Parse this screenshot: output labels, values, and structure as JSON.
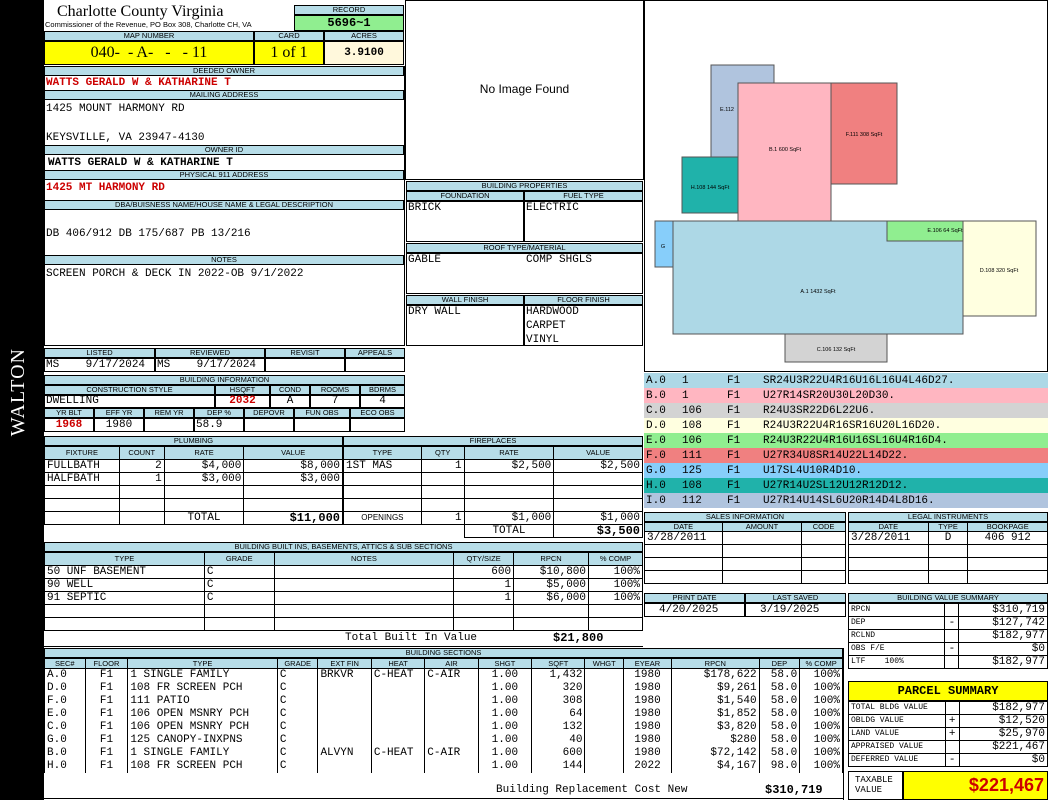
{
  "sidebar_text": "WALTON",
  "header": {
    "county": "Charlotte County Virginia",
    "commissioner": "Commissioner of the Revenue, PO Box 308, Charlotte CH, VA",
    "record_label": "RECORD",
    "record": "5696~1",
    "map_label": "MAP NUMBER",
    "map": "040-  - A-   -   - 11",
    "card_label": "CARD",
    "card": "1 of 1",
    "acres_label": "ACRES",
    "acres": "3.9100"
  },
  "owner": {
    "deeded_label": "DEEDED OWNER",
    "deeded": "WATTS GERALD W & KATHARINE T",
    "mailing_label": "MAILING ADDRESS",
    "mail1": "1425 MOUNT HARMONY RD",
    "mail2": "KEYSVILLE, VA 23947-4130",
    "owner_id_label": "OWNER ID",
    "owner_id": "WATTS GERALD W & KATHARINE T",
    "phys_label": "PHYSICAL 911 ADDRESS",
    "phys": "1425 MT HARMONY RD",
    "dba_label": "DBA/BUISNESS NAME/HOUSE NAME & LEGAL DESCRIPTION",
    "dba": "DB 406/912 DB 175/687 PB 13/216",
    "notes_label": "NOTES",
    "notes": "SCREEN PORCH & DECK IN 2022-OB 9/1/2022"
  },
  "image_text": "No Image Found",
  "listed": {
    "listed_label": "LISTED",
    "listed": "MS    9/17/2024",
    "reviewed_label": "REVIEWED",
    "reviewed": "MS    9/17/2024",
    "revisit_label": "REVISIT",
    "appeals_label": "APPEALS"
  },
  "building_info": {
    "label": "BUILDING INFORMATION",
    "cs_label": "CONSTRUCTION STYLE",
    "cs": "DWELLING",
    "hsqft_label": "HSQFT",
    "hsqft": "2032",
    "cond_label": "COND",
    "cond": "A",
    "rooms_label": "ROOMS",
    "rooms": "7",
    "bdrms_label": "BDRMS",
    "bdrms": "4",
    "yrblt_label": "YR BLT",
    "yrblt": "1968",
    "effyr_label": "EFF YR",
    "effyr": "1980",
    "remyr_label": "REM YR",
    "dep_label": "DEP %",
    "dep": "58.9",
    "depovr_label": "DEPOVR",
    "funobs_label": "FUN OBS",
    "ecoobs_label": "ECO OBS"
  },
  "bprops": {
    "label": "BUILDING PROPERTIES",
    "foundation_label": "FOUNDATION",
    "foundation": "BRICK",
    "fuel_label": "FUEL TYPE",
    "fuel": "ELECTRIC",
    "roof_label": "ROOF TYPE/MATERIAL",
    "roof1": "GABLE",
    "roof2": "COMP SHGLS",
    "wall_label": "WALL FINISH",
    "wall": "DRY WALL",
    "floor_label": "FLOOR FINISH",
    "floors": [
      "HARDWOOD",
      "CARPET",
      "VINYL"
    ]
  },
  "plumbing": {
    "label": "PLUMBING",
    "headers": [
      "FIXTURE",
      "COUNT",
      "RATE",
      "VALUE"
    ],
    "rows": [
      [
        "FULLBATH",
        "2",
        "$4,000",
        "$8,000"
      ],
      [
        "HALFBATH",
        "1",
        "$3,000",
        "$3,000"
      ]
    ],
    "total_label": "TOTAL",
    "total": "$11,000"
  },
  "fireplaces": {
    "label": "FIREPLACES",
    "headers": [
      "TYPE",
      "QTY",
      "RATE",
      "VALUE"
    ],
    "rows": [
      [
        "1ST MAS",
        "1",
        "$2,500",
        "$2,500"
      ]
    ],
    "openings_label": "OPENINGS",
    "openings": [
      "1",
      "$1,000",
      "$1,000"
    ],
    "total_label": "TOTAL",
    "total": "$3,500"
  },
  "builtins": {
    "label": "BUILDING BUILT INS, BASEMENTS, ATTICS & SUB SECTIONS",
    "headers": [
      "TYPE",
      "GRADE",
      "NOTES",
      "QTY/SIZE",
      "RPCN",
      "% COMP"
    ],
    "rows": [
      [
        "50 UNF BASEMENT",
        "C",
        "",
        "600",
        "$10,800",
        "100%"
      ],
      [
        "90 WELL",
        "C",
        "",
        "1",
        "$5,000",
        "100%"
      ],
      [
        "91 SEPTIC",
        "C",
        "",
        "1",
        "$6,000",
        "100%"
      ]
    ],
    "total_label": "Total Built In Value",
    "total": "$21,800"
  },
  "sections": {
    "label": "BUILDING SECTIONS",
    "headers": [
      "SEC#",
      "FLOOR",
      "TYPE",
      "GRADE",
      "EXT FIN",
      "HEAT",
      "AIR",
      "SHGT",
      "SQFT",
      "WHGT",
      "EYEAR",
      "RPCN",
      "DEP",
      "% COMP"
    ],
    "rows": [
      [
        "A.0",
        "F1",
        "1 SINGLE FAMILY",
        "C",
        "BRKVR",
        "C-HEAT",
        "C-AIR",
        "1.00",
        "1,432",
        "",
        "1980",
        "$178,622",
        "58.0",
        "100%"
      ],
      [
        "D.0",
        "F1",
        "108 FR SCREEN PCH",
        "C",
        "",
        "",
        "",
        "1.00",
        "320",
        "",
        "1980",
        "$9,261",
        "58.0",
        "100%"
      ],
      [
        "F.0",
        "F1",
        "111 PATIO",
        "C",
        "",
        "",
        "",
        "1.00",
        "308",
        "",
        "1980",
        "$1,540",
        "58.0",
        "100%"
      ],
      [
        "E.0",
        "F1",
        "106 OPEN MSNRY PCH",
        "C",
        "",
        "",
        "",
        "1.00",
        "64",
        "",
        "1980",
        "$1,852",
        "58.0",
        "100%"
      ],
      [
        "C.0",
        "F1",
        "106 OPEN MSNRY PCH",
        "C",
        "",
        "",
        "",
        "1.00",
        "132",
        "",
        "1980",
        "$3,820",
        "58.0",
        "100%"
      ],
      [
        "G.0",
        "F1",
        "125 CANOPY-INXPNS",
        "C",
        "",
        "",
        "",
        "1.00",
        "40",
        "",
        "1980",
        "$280",
        "58.0",
        "100%"
      ],
      [
        "B.0",
        "F1",
        "1 SINGLE FAMILY",
        "C",
        "ALVYN",
        "C-HEAT",
        "C-AIR",
        "1.00",
        "600",
        "",
        "1980",
        "$72,142",
        "58.0",
        "100%"
      ],
      [
        "H.0",
        "F1",
        "108 FR SCREEN PCH",
        "C",
        "",
        "",
        "",
        "1.00",
        "144",
        "",
        "2022",
        "$4,167",
        "98.0",
        "100%"
      ]
    ],
    "cost_label": "Building Replacement Cost New",
    "cost": "$310,719"
  },
  "sketch_labels": [
    {
      "t": "E.112"
    },
    {
      "t": "B.1 600 SqFt"
    },
    {
      "t": "F.111 308 SqFt"
    },
    {
      "t": "H.108 144 SqFt"
    },
    {
      "t": "A.1 1432 SqFt"
    },
    {
      "t": "E.106 64 SqFt"
    },
    {
      "t": "D.108 320 SqFt"
    },
    {
      "t": "C.106 132 SqFt"
    },
    {
      "t": "G"
    }
  ],
  "segments": [
    {
      "id": "A.0",
      "n": "1",
      "f": "F1",
      "path": "SR24U3R22U4R16U16L16U4L46D27.",
      "color": "#add8e6"
    },
    {
      "id": "B.0",
      "n": "1",
      "f": "F1",
      "path": "U27R14SR20U30L20D30.",
      "color": "#ffb6c1"
    },
    {
      "id": "C.0",
      "n": "106",
      "f": "F1",
      "path": "R24U3SR22D6L22U6.",
      "color": "#d3d3d3"
    },
    {
      "id": "D.0",
      "n": "108",
      "f": "F1",
      "path": "R24U3R22U4R16SR16U20L16D20.",
      "color": "#ffffe0"
    },
    {
      "id": "E.0",
      "n": "106",
      "f": "F1",
      "path": "R24U3R22U4R16U16SL16U4R16D4.",
      "color": "#90ee90"
    },
    {
      "id": "F.0",
      "n": "111",
      "f": "F1",
      "path": "U27R34U8SR14U22L14D22.",
      "color": "#f08080"
    },
    {
      "id": "G.0",
      "n": "125",
      "f": "F1",
      "path": "U17SL4U10R4D10.",
      "color": "#87cefa"
    },
    {
      "id": "H.0",
      "n": "108",
      "f": "F1",
      "path": "U27R14U2SL12U12R12D12.",
      "color": "#20b2aa"
    },
    {
      "id": "I.0",
      "n": "112",
      "f": "F1",
      "path": "U27R14U14SL6U20R14D4L8D16.",
      "color": "#b0c4de"
    }
  ],
  "sales": {
    "label": "SALES INFORMATION",
    "headers": [
      "DATE",
      "AMOUNT",
      "CODE"
    ],
    "date": "3/28/2011"
  },
  "legal": {
    "label": "LEGAL INSTRUMENTS",
    "headers": [
      "DATE",
      "TYPE",
      "BOOKPAGE"
    ],
    "date": "3/28/2011",
    "type": "D",
    "bookpage": "406 912"
  },
  "print": {
    "print_label": "PRINT DATE",
    "print": "4/20/2025",
    "saved_label": "LAST SAVED",
    "saved": "3/19/2025"
  },
  "bvs": {
    "label": "BUILDING VALUE SUMMARY",
    "rows": [
      [
        "RPCN",
        "",
        "$310,719"
      ],
      [
        "DEP",
        "-",
        "$127,742"
      ],
      [
        "RCLND",
        "",
        "$182,977"
      ],
      [
        "OBS F/E",
        "-",
        "$0"
      ],
      [
        "LTF    100%",
        "",
        "$182,977"
      ]
    ]
  },
  "parcel": {
    "label": "PARCEL SUMMARY",
    "rows": [
      [
        "TOTAL BLDG VALUE",
        "",
        "$182,977"
      ],
      [
        "OBLDG VALUE",
        "+",
        "$12,520"
      ],
      [
        "LAND VALUE",
        "+",
        "$25,970"
      ],
      [
        "APPRAISED VALUE",
        "",
        "$221,467"
      ],
      [
        "DEFERRED VALUE",
        "-",
        "$0"
      ]
    ],
    "taxable_label": "TAXABLE VALUE",
    "taxable": "$221,467"
  }
}
